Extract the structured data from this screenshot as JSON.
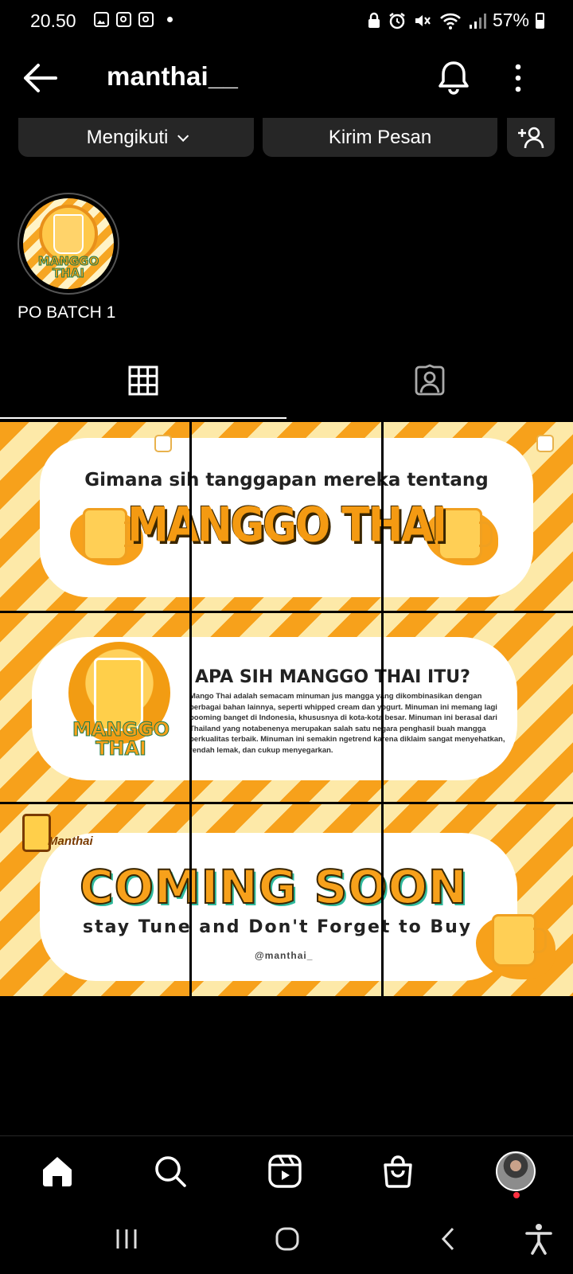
{
  "status_bar": {
    "time": "20.50",
    "battery": "57%"
  },
  "header": {
    "username": "manthai__"
  },
  "actions": {
    "follow_label": "Mengikuti",
    "message_label": "Kirim Pesan"
  },
  "highlight": {
    "label": "PO BATCH 1",
    "cover_text": "MANGGO THAI"
  },
  "posts": [
    {
      "subtitle": "Gimana sih tanggapan mereka tentang",
      "title": "MANGGO THAI"
    },
    {
      "title": "APA SIH MANGGO THAI ITU?",
      "body": "Mango Thai adalah semacam minuman jus mangga yang dikombinasikan dengan berbagai bahan lainnya, seperti whipped cream dan yogurt. Minuman ini memang lagi booming banget di Indonesia, khususnya di kota-kota besar. Minuman ini berasal dari Thailand yang notabenenya merupakan salah satu negara penghasil buah mangga berkualitas terbaik. Minuman ini semakin ngetrend karena diklaim sangat menyehatkan, rendah lemak, dan cukup menyegarkan.",
      "cup_label": "MANGGO THAI"
    },
    {
      "logo": "Manthai",
      "title": "COMING SOON",
      "subtitle": "stay Tune and Don't Forget to Buy",
      "handle": "@manthai_"
    }
  ],
  "colors": {
    "background": "#000000",
    "button_bg": "#262626",
    "accent_orange": "#f7a11b",
    "stripe_light": "#fde9a8",
    "notification": "#ff3040"
  }
}
